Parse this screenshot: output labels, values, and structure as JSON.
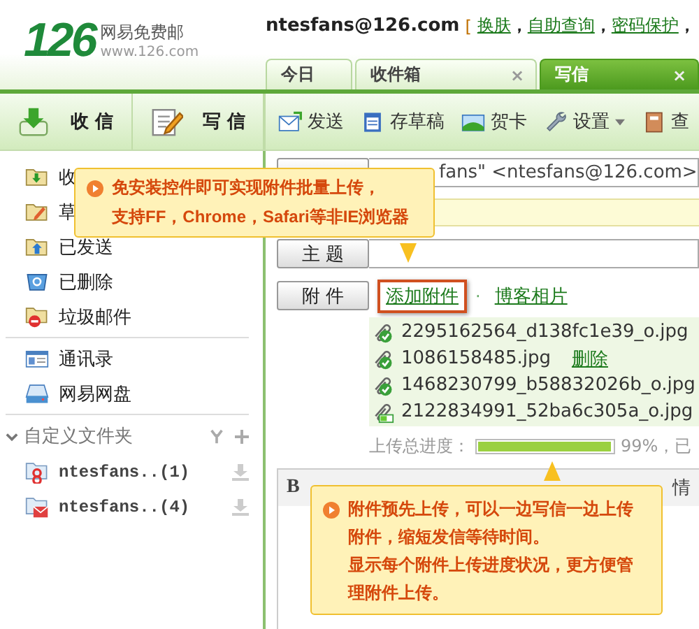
{
  "header": {
    "logo": "126",
    "brand": "网易免费邮",
    "url": "www.126.com",
    "user": "ntesfans@126.com",
    "bracket": "[",
    "links": [
      "换肤",
      "自助查询",
      "密码保护"
    ],
    "separator": "，"
  },
  "tabs": [
    {
      "label": "今日",
      "selected": false
    },
    {
      "label": "收件箱",
      "selected": false,
      "close": "×"
    },
    {
      "label": "写信",
      "selected": true,
      "close": "×"
    }
  ],
  "main_buttons": [
    {
      "label": "收 信",
      "kind": "receive"
    },
    {
      "label": "写 信",
      "kind": "write"
    }
  ],
  "toolbar": [
    {
      "label": "发送",
      "kind": "send"
    },
    {
      "label": "存草稿",
      "kind": "save"
    },
    {
      "label": "贺卡",
      "kind": "card"
    },
    {
      "label": "设置",
      "kind": "settings",
      "dropdown": true
    },
    {
      "label": "查",
      "kind": "book"
    }
  ],
  "sidebar": {
    "folders": [
      {
        "label": "收",
        "kind": "inbox"
      },
      {
        "label": "草",
        "kind": "draft"
      },
      {
        "label": "已发送",
        "kind": "sent"
      },
      {
        "label": "已删除",
        "kind": "trash"
      },
      {
        "label": "垃圾邮件",
        "kind": "spam"
      }
    ],
    "tools": [
      {
        "label": "通讯录",
        "kind": "contacts"
      },
      {
        "label": "网易网盘",
        "kind": "disk"
      }
    ],
    "custom": {
      "title": "自定义文件夹",
      "expanded": true,
      "items": [
        {
          "label": "ntesfans..(1)",
          "kind": "person"
        },
        {
          "label": "ntesfans..(4)",
          "kind": "mail"
        }
      ]
    }
  },
  "compose": {
    "from": {
      "value": "fans\" <ntesfans@126.com>"
    },
    "subject": {
      "label": "主 题"
    },
    "attach": {
      "label": "附 件",
      "separator": "·",
      "links": [
        {
          "label": "添加附件",
          "highlighted": true
        },
        {
          "label": "博客相片",
          "highlighted": false
        }
      ]
    },
    "files": [
      {
        "name": "2295162564_d138fc1e39_o.jpg",
        "done": true
      },
      {
        "name": "1086158485.jpg",
        "done": true,
        "action": "删除"
      },
      {
        "name": "1468230799_b58832026b_o.jpg",
        "done": true
      },
      {
        "name": "2122834991_52ba6c305a_o.jpg",
        "done": false
      }
    ],
    "progress": {
      "label": "上传总进度：",
      "level": 0.99,
      "reading": "99%，已"
    },
    "editor": {
      "bold": "B",
      "emotion": "情"
    }
  },
  "tips": [
    {
      "paragraphs": [
        "免安装控件即可实现附件批量上传，",
        "支持FF，Chrome，Safari等非IE浏览器"
      ]
    },
    {
      "paragraphs": [
        "附件预先上传，可以一边写信一边上传附件，缩短发信等待时间。",
        "显示每个附件上传进度状况，更方便管理附件上传。"
      ]
    }
  ]
}
